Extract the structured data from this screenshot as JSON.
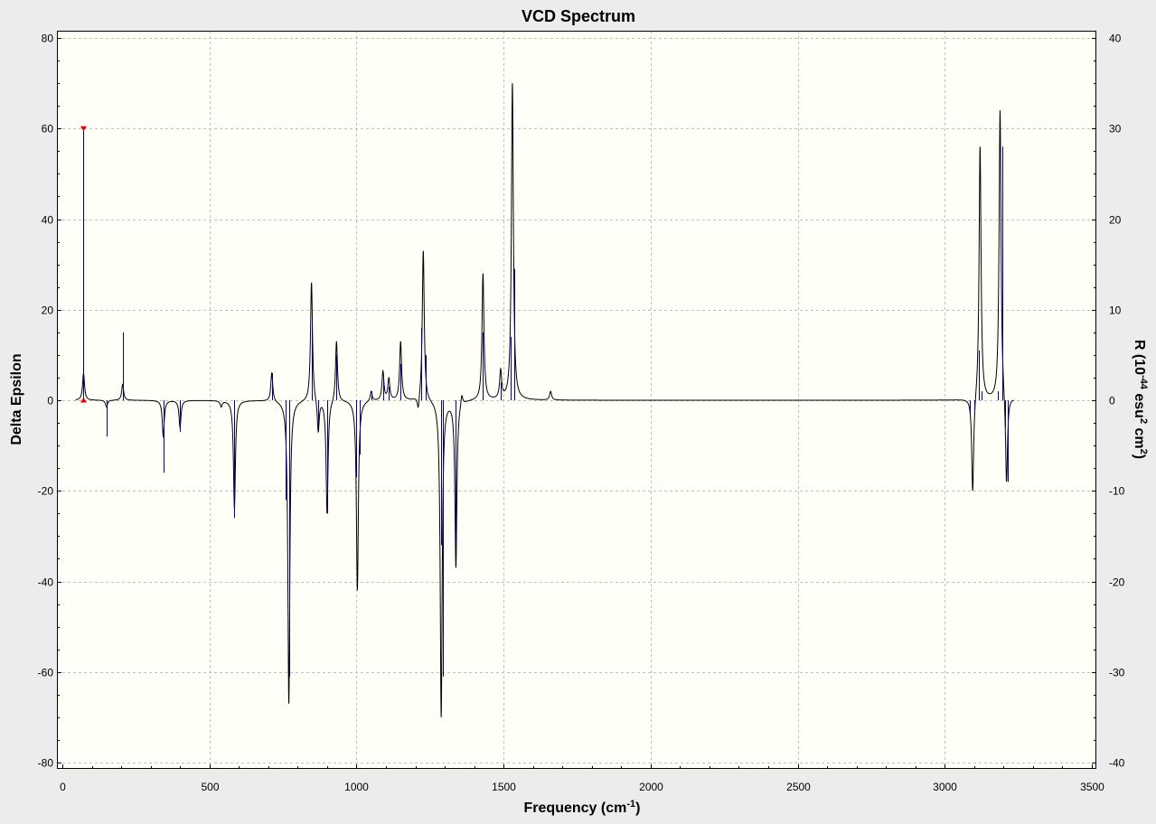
{
  "window": {
    "title": "VCD Spectrum"
  },
  "chart_data": {
    "type": "line",
    "title": "VCD Spectrum",
    "xlabel": {
      "prefix": "Frequency (cm",
      "sup": "-1",
      "suffix": ")"
    },
    "ylabel_left": "Delta Epsilon",
    "ylabel_right": {
      "p1": "R (10",
      "sup1": "-44",
      "p2": " esu",
      "sup2": "2",
      "p3": " cm",
      "sup3": "2",
      "p4": ")"
    },
    "xlim": [
      0,
      3500
    ],
    "ylim_left": [
      -80,
      80
    ],
    "ylim_right": [
      -40,
      40
    ],
    "xticks": [
      0,
      500,
      1000,
      1500,
      2000,
      2500,
      3000,
      3500
    ],
    "yticks_left": [
      -80,
      -60,
      -40,
      -20,
      0,
      20,
      40,
      60,
      80
    ],
    "yticks_right": [
      -40,
      -30,
      -20,
      -10,
      0,
      10,
      20,
      30,
      40
    ],
    "grid": true,
    "peak_halfwidth_cm1": 4,
    "spectrum_range": [
      45,
      3235
    ],
    "series": [
      {
        "kind": "spectrum_line",
        "color": "#000000",
        "peaks": [
          {
            "x": 72,
            "y": 6
          },
          {
            "x": 150,
            "y": -1.5
          },
          {
            "x": 205,
            "y": 3.5
          },
          {
            "x": 343,
            "y": -8
          },
          {
            "x": 400,
            "y": -6
          },
          {
            "x": 540,
            "y": -1.5
          },
          {
            "x": 585,
            "y": -24
          },
          {
            "x": 712,
            "y": 6
          },
          {
            "x": 770,
            "y": -67
          },
          {
            "x": 847,
            "y": 26
          },
          {
            "x": 870,
            "y": -7
          },
          {
            "x": 900,
            "y": -25
          },
          {
            "x": 932,
            "y": 13
          },
          {
            "x": 1003,
            "y": -42
          },
          {
            "x": 1050,
            "y": 2
          },
          {
            "x": 1090,
            "y": 6.5
          },
          {
            "x": 1110,
            "y": 5
          },
          {
            "x": 1150,
            "y": 13
          },
          {
            "x": 1210,
            "y": -1.5
          },
          {
            "x": 1227,
            "y": 33
          },
          {
            "x": 1288,
            "y": -70
          },
          {
            "x": 1338,
            "y": -37
          },
          {
            "x": 1358,
            "y": 1
          },
          {
            "x": 1430,
            "y": 28
          },
          {
            "x": 1490,
            "y": 7
          },
          {
            "x": 1530,
            "y": 70
          },
          {
            "x": 1660,
            "y": 2
          },
          {
            "x": 3095,
            "y": -20
          },
          {
            "x": 3120,
            "y": 56
          },
          {
            "x": 3188,
            "y": 64
          },
          {
            "x": 3210,
            "y": -18
          }
        ]
      },
      {
        "kind": "rotational_strength_sticks",
        "color": "#00008b",
        "axis": "right",
        "sticks": [
          {
            "x": 72,
            "r": 30
          },
          {
            "x": 150,
            "r": -4
          },
          {
            "x": 205,
            "r": 7.5
          },
          {
            "x": 343,
            "r": -8
          },
          {
            "x": 400,
            "r": -3.5
          },
          {
            "x": 585,
            "r": -13
          },
          {
            "x": 712,
            "r": 3
          },
          {
            "x": 760,
            "r": -11
          },
          {
            "x": 770,
            "r": -30.5
          },
          {
            "x": 847,
            "r": 9
          },
          {
            "x": 870,
            "r": -3
          },
          {
            "x": 900,
            "r": -12.5
          },
          {
            "x": 932,
            "r": 5
          },
          {
            "x": 1000,
            "r": -8.5
          },
          {
            "x": 1010,
            "r": -6
          },
          {
            "x": 1050,
            "r": 1
          },
          {
            "x": 1090,
            "r": 2.5
          },
          {
            "x": 1110,
            "r": 1.5
          },
          {
            "x": 1150,
            "r": 4
          },
          {
            "x": 1220,
            "r": 8
          },
          {
            "x": 1235,
            "r": 5
          },
          {
            "x": 1286,
            "r": -16
          },
          {
            "x": 1293,
            "r": -30.5
          },
          {
            "x": 1338,
            "r": -16
          },
          {
            "x": 1430,
            "r": 7.5
          },
          {
            "x": 1490,
            "r": 2
          },
          {
            "x": 1525,
            "r": 7
          },
          {
            "x": 1537,
            "r": 14.5
          },
          {
            "x": 3085,
            "r": -1.5
          },
          {
            "x": 3100,
            "r": -1.5
          },
          {
            "x": 3115,
            "r": 5.5
          },
          {
            "x": 3125,
            "r": 1
          },
          {
            "x": 3180,
            "r": 1
          },
          {
            "x": 3195,
            "r": 28
          },
          {
            "x": 3205,
            "r": -3
          },
          {
            "x": 3215,
            "r": -9
          }
        ]
      }
    ],
    "markers": {
      "color": "#e00000",
      "stick_x": 72,
      "top_r": 30,
      "bottom_r": 0
    }
  },
  "colors": {
    "window_bg": "#ececec",
    "plot_bg": "#fffff7",
    "grid": "#c0c0c0",
    "axis": "#000000"
  }
}
